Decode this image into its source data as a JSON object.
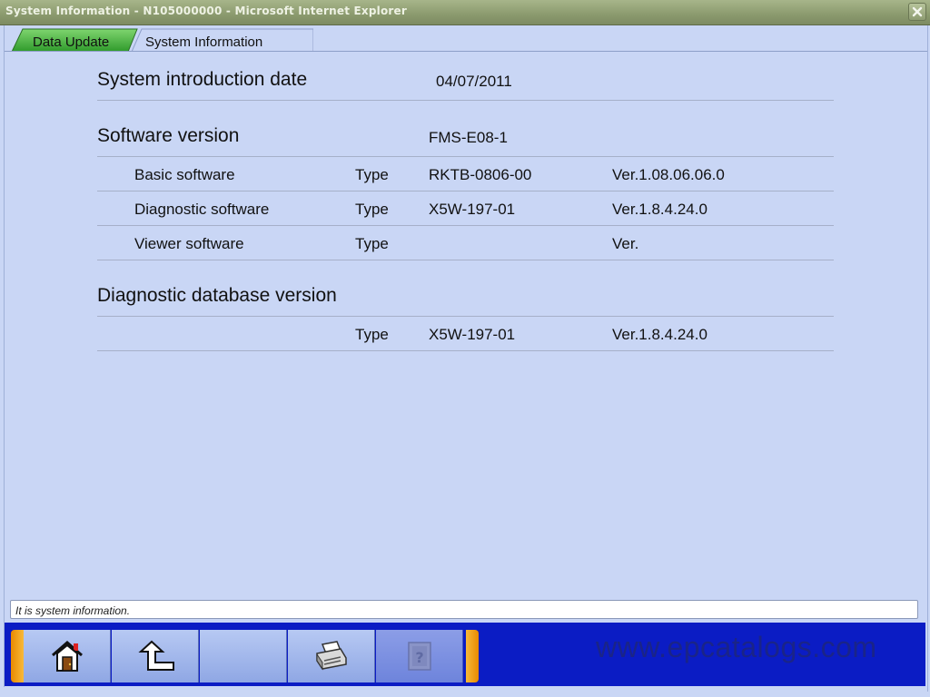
{
  "window": {
    "title": "System Information - N105000000 - Microsoft Internet Explorer"
  },
  "tabs": [
    {
      "label": "Data Update",
      "active": false
    },
    {
      "label": "System Information",
      "active": true
    }
  ],
  "system_intro": {
    "label": "System introduction date",
    "value": "04/07/2011"
  },
  "software": {
    "label": "Software version",
    "value": "FMS-E08-1",
    "rows": [
      {
        "name": "Basic software",
        "type_label": "Type",
        "type_value": "RKTB-0806-00",
        "version": "Ver.1.08.06.06.0"
      },
      {
        "name": "Diagnostic software",
        "type_label": "Type",
        "type_value": "X5W-197-01",
        "version": "Ver.1.8.4.24.0"
      },
      {
        "name": "Viewer software",
        "type_label": "Type",
        "type_value": "",
        "version": "Ver."
      }
    ]
  },
  "database": {
    "label": "Diagnostic database version",
    "type_label": "Type",
    "type_value": "X5W-197-01",
    "version": "Ver.1.8.4.24.0"
  },
  "status": {
    "message": "It is system information."
  },
  "toolbar": {
    "buttons": [
      {
        "icon": "home-icon",
        "enabled": true
      },
      {
        "icon": "back-arrow-icon",
        "enabled": true
      },
      {
        "icon": "blank",
        "enabled": true
      },
      {
        "icon": "printer-icon",
        "enabled": true
      },
      {
        "icon": "help-icon",
        "enabled": false
      }
    ]
  },
  "watermark": "www.epcatalogs.com",
  "colors": {
    "background": "#c9d6f5",
    "toolbar": "#0b1cc4",
    "accent_tab": "#3fa83a",
    "toolbar_cap": "#f7b93a"
  }
}
